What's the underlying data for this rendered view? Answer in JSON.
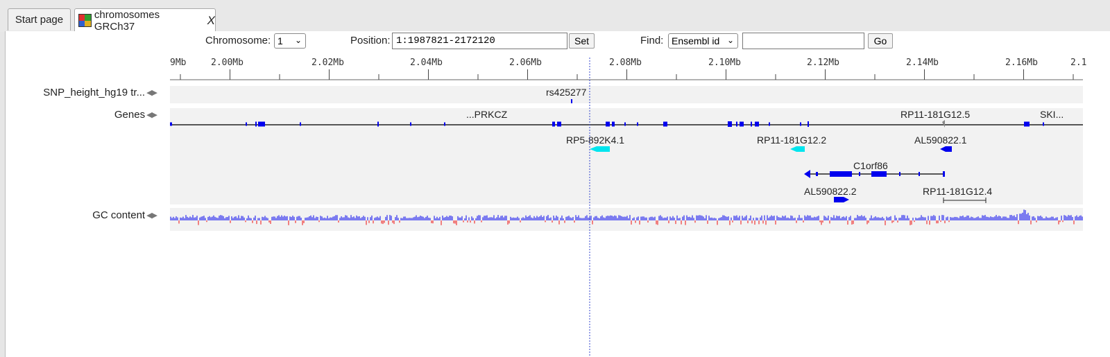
{
  "tabs": [
    {
      "label": "Start page"
    },
    {
      "label": "chromosomes GRCh37",
      "close": "X"
    }
  ],
  "controls": {
    "chromosome_label": "Chromosome:",
    "chromosome_value": "1",
    "position_label": "Position:",
    "position_value": "1:1987821-2172120",
    "set_label": "Set",
    "find_label": "Find:",
    "find_type": "Ensembl id",
    "find_value": "",
    "go_label": "Go"
  },
  "ruler": {
    "labels": [
      "9Mb",
      "2.00Mb",
      "2.02Mb",
      "2.04Mb",
      "2.06Mb",
      "2.08Mb",
      "2.10Mb",
      "2.12Mb",
      "2.14Mb",
      "2.16Mb",
      "2.1"
    ]
  },
  "tracks": {
    "snp": {
      "label": "SNP_height_hg19 tr...",
      "feature": "rs425277"
    },
    "genes": {
      "label": "Genes",
      "names": [
        "...PRKCZ",
        "RP11-181G12.5",
        "SKI...",
        "RP5-892K4.1",
        "RP11-181G12.2",
        "AL590822.1",
        "C1orf86",
        "AL590822.2",
        "RP11-181G12.4"
      ]
    },
    "gc": {
      "label": "GC content"
    }
  },
  "colors": {
    "gene": "#0000ee",
    "gene_highlight": "#00e5ee",
    "gc_high": "#7b7bf0",
    "gc_low": "#f08080",
    "cursor": "#3344cc"
  }
}
